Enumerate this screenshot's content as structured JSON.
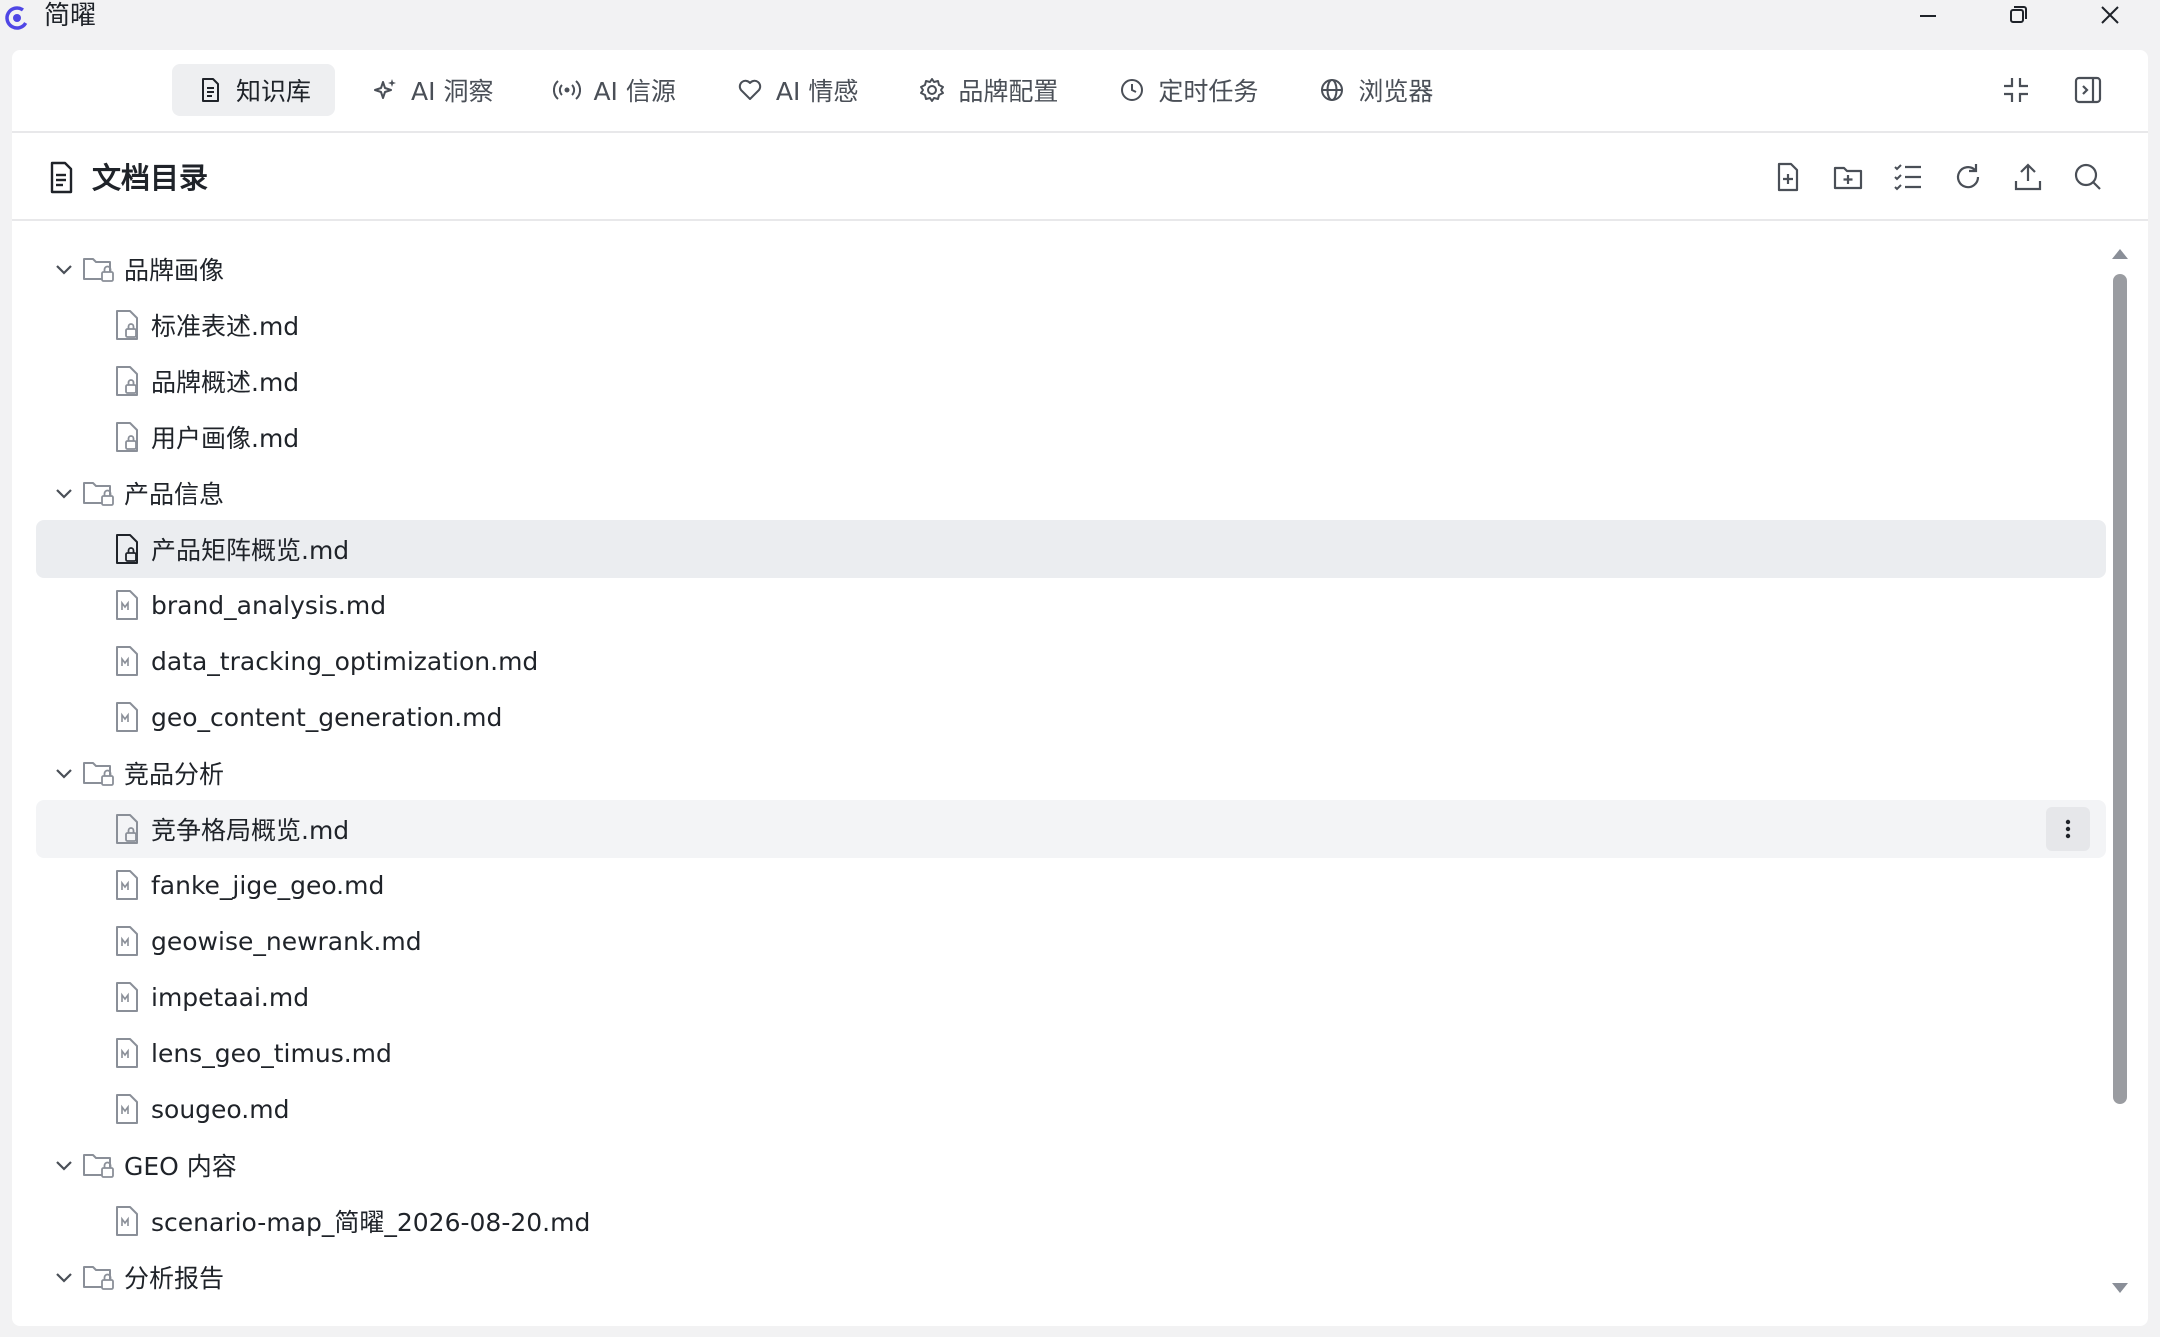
{
  "window": {
    "title": "简曜",
    "logo_icon": "app-logo-icon",
    "controls": [
      "minimize-icon",
      "restore-icon",
      "close-icon"
    ]
  },
  "nav": {
    "tabs": [
      {
        "label": "知识库",
        "icon": "document-icon",
        "active": true
      },
      {
        "label": "AI 洞察",
        "icon": "sparkle-icon",
        "active": false
      },
      {
        "label": "AI 信源",
        "icon": "broadcast-icon",
        "active": false
      },
      {
        "label": "AI 情感",
        "icon": "heart-icon",
        "active": false
      },
      {
        "label": "品牌配置",
        "icon": "gear-icon",
        "active": false
      },
      {
        "label": "定时任务",
        "icon": "clock-icon",
        "active": false
      },
      {
        "label": "浏览器",
        "icon": "globe-icon",
        "active": false
      }
    ],
    "right_icons": [
      "collapse-icon",
      "sidebar-toggle-icon"
    ]
  },
  "doc": {
    "title": "文档目录",
    "toolbar": [
      "new-file-icon",
      "new-folder-icon",
      "list-icon",
      "refresh-icon",
      "upload-icon",
      "search-icon"
    ]
  },
  "tree": {
    "folders": [
      {
        "label": "品牌画像",
        "files": [
          {
            "label": "标准表述.md",
            "type": "locked"
          },
          {
            "label": "品牌概述.md",
            "type": "locked"
          },
          {
            "label": "用户画像.md",
            "type": "locked"
          }
        ]
      },
      {
        "label": "产品信息",
        "files": [
          {
            "label": "产品矩阵概览.md",
            "type": "locked",
            "selected": true
          },
          {
            "label": "brand_analysis.md",
            "type": "markdown"
          },
          {
            "label": "data_tracking_optimization.md",
            "type": "markdown"
          },
          {
            "label": "geo_content_generation.md",
            "type": "markdown"
          }
        ]
      },
      {
        "label": "竞品分析",
        "files": [
          {
            "label": "竞争格局概览.md",
            "type": "locked",
            "hover": true
          },
          {
            "label": "fanke_jige_geo.md",
            "type": "markdown"
          },
          {
            "label": "geowise_newrank.md",
            "type": "markdown"
          },
          {
            "label": "impetaai.md",
            "type": "markdown"
          },
          {
            "label": "lens_geo_timus.md",
            "type": "markdown"
          },
          {
            "label": "sougeo.md",
            "type": "markdown"
          }
        ]
      },
      {
        "label": "GEO 内容",
        "files": [
          {
            "label": "scenario-map_简曜_2026-08-20.md",
            "type": "markdown"
          }
        ]
      },
      {
        "label": "分析报告",
        "files": []
      }
    ]
  },
  "colors": {
    "accent": "#4f46e5",
    "selected_row": "#ebedf0",
    "icon_gray": "#8a8f98"
  }
}
